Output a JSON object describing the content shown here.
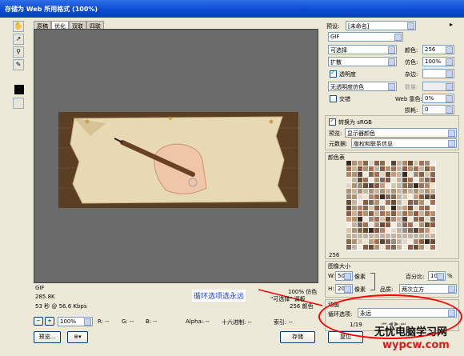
{
  "window": {
    "title": "存储为 Web 所用格式 (100%)"
  },
  "tabs": [
    "原稿",
    "优化",
    "双联",
    "四联"
  ],
  "status": {
    "format": "GIF",
    "size": "285.8K",
    "time": "53 秒 @ 56.6 Kbps",
    "quality": "100% 仿色",
    "palette": "256 颜色",
    "note_left": "\"可选择\" 调板",
    "annotation": "循环选项选永远"
  },
  "bottom_bar": {
    "zoom": "100%",
    "r": "R: --",
    "g": "G: --",
    "b": "B: --",
    "alpha": "Alpha: --",
    "hex": "十六进制: --",
    "index": "索引: --",
    "preview_label": "预览...",
    "save_label": "存储",
    "reset_label": "复位"
  },
  "settings": {
    "preset_label": "预设:",
    "preset_value": "[未命名]",
    "format_value": "GIF",
    "reduction": "可选择",
    "colors_label": "颜色:",
    "colors_value": "256",
    "dither_algo": "扩散",
    "dither_label": "仿色:",
    "dither_value": "100%",
    "transparency_label": "透明度",
    "matte_label": "杂边:",
    "trans_dither": "无透明度仿色",
    "amount_label": "数量:",
    "interlaced_label": "交错",
    "web_snap_label": "Web 靠色:",
    "web_snap_value": "0%",
    "lossy_label": "损耗:",
    "lossy_value": "0",
    "srgb_label": "转换为 sRGB",
    "preview_label": "预览:",
    "preview_value": "显示器颜色",
    "metadata_label": "元数据:",
    "metadata_value": "版权和联系信息"
  },
  "color_table": {
    "title": "颜色表",
    "count": "256"
  },
  "image_size": {
    "title": "图像大小",
    "w_label": "W:",
    "w_value": "500",
    "h_label": "H:",
    "h_value": "200",
    "unit": "像素",
    "percent_label": "百分比:",
    "percent_value": "100",
    "percent_unit": "%",
    "quality_label": "品质:",
    "quality_value": "两次立方"
  },
  "animation": {
    "title": "动画",
    "loop_label": "循环选项:",
    "loop_value": "永远",
    "frame": "1/19"
  },
  "watermark": {
    "line1": "无忧电脑学习网",
    "line2": "wypcw.com"
  },
  "colors": {
    "annotation": "#ff0000",
    "annotation_text": "#1a3fd0",
    "canvas_bg": "#6b6b6b"
  }
}
